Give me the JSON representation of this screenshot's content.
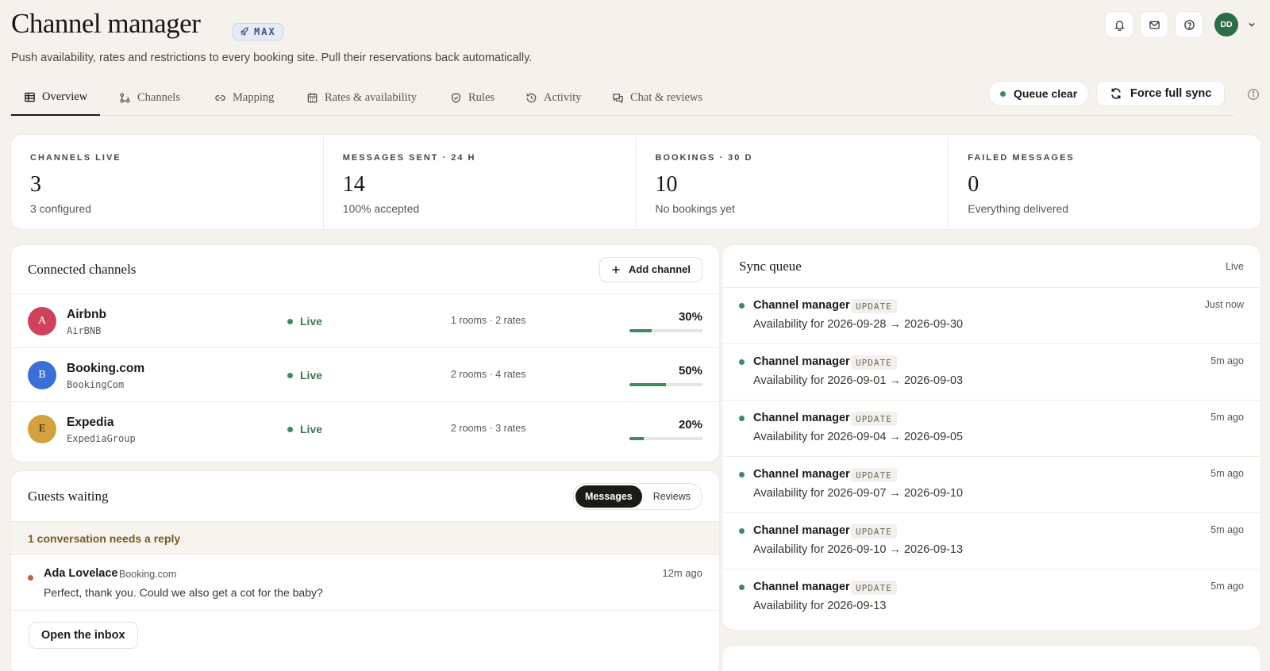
{
  "header": {
    "title": "Channel manager",
    "badge": "MAX",
    "subtitle": "Push availability, rates and restrictions to every booking site. Pull their reservations back automatically.",
    "avatar_initials": "DD"
  },
  "tabs": [
    {
      "label": "Overview",
      "icon": "table-icon",
      "active": true
    },
    {
      "label": "Channels",
      "icon": "channels-icon",
      "active": false
    },
    {
      "label": "Mapping",
      "icon": "link-icon",
      "active": false
    },
    {
      "label": "Rates & availability",
      "icon": "calendar-icon",
      "active": false
    },
    {
      "label": "Rules",
      "icon": "shield-icon",
      "active": false
    },
    {
      "label": "Activity",
      "icon": "history-icon",
      "active": false
    },
    {
      "label": "Chat & reviews",
      "icon": "chat-icon",
      "active": false
    }
  ],
  "actions": {
    "queue_status": "Queue clear",
    "force_sync": "Force full sync"
  },
  "stats": [
    {
      "label": "CHANNELS LIVE",
      "value": "3",
      "sub": "3 configured"
    },
    {
      "label": "MESSAGES SENT · 24 H",
      "value": "14",
      "sub": "100% accepted"
    },
    {
      "label": "BOOKINGS · 30 D",
      "value": "10",
      "sub": "No bookings yet"
    },
    {
      "label": "FAILED MESSAGES",
      "value": "0",
      "sub": "Everything delivered"
    }
  ],
  "channels": {
    "title": "Connected channels",
    "add_label": "Add channel",
    "items": [
      {
        "initial": "A",
        "name": "Airbnb",
        "code": "AirBNB",
        "status": "Live",
        "meta": "1 rooms · 2 rates",
        "percent_label": "30%",
        "percent": 0.3,
        "color": "#d0425c"
      },
      {
        "initial": "B",
        "name": "Booking.com",
        "code": "BookingCom",
        "status": "Live",
        "meta": "2 rooms · 4 rates",
        "percent_label": "50%",
        "percent": 0.5,
        "color": "#3a6fd8"
      },
      {
        "initial": "E",
        "name": "Expedia",
        "code": "ExpediaGroup",
        "status": "Live",
        "meta": "2 rooms · 3 rates",
        "percent_label": "20%",
        "percent": 0.2,
        "color": "#d4a140"
      }
    ]
  },
  "guests": {
    "title": "Guests waiting",
    "seg_messages": "Messages",
    "seg_reviews": "Reviews",
    "needs_reply": "1 conversation needs a reply",
    "conversation": {
      "name": "Ada Lovelace",
      "source": "Booking.com",
      "message": "Perfect, thank you. Could we also get a cot for the baby?",
      "time": "12m ago"
    },
    "inbox_label": "Open the inbox"
  },
  "queue": {
    "title": "Sync queue",
    "live_label": "Live",
    "items": [
      {
        "title": "Channel manager",
        "tag": "UPDATE",
        "desc": "Availability for 2026-09-28 → 2026-09-30",
        "time": "Just now"
      },
      {
        "title": "Channel manager",
        "tag": "UPDATE",
        "desc": "Availability for 2026-09-01 → 2026-09-03",
        "time": "5m ago"
      },
      {
        "title": "Channel manager",
        "tag": "UPDATE",
        "desc": "Availability for 2026-09-04 → 2026-09-05",
        "time": "5m ago"
      },
      {
        "title": "Channel manager",
        "tag": "UPDATE",
        "desc": "Availability for 2026-09-07 → 2026-09-10",
        "time": "5m ago"
      },
      {
        "title": "Channel manager",
        "tag": "UPDATE",
        "desc": "Availability for 2026-09-10 → 2026-09-13",
        "time": "5m ago"
      },
      {
        "title": "Channel manager",
        "tag": "UPDATE",
        "desc": "Availability for 2026-09-13",
        "time": "5m ago"
      }
    ]
  },
  "colors": {
    "accent_green": "#3f8a5f",
    "avatar_green": "#2e6b47",
    "warning_text": "#7a5a1e"
  }
}
